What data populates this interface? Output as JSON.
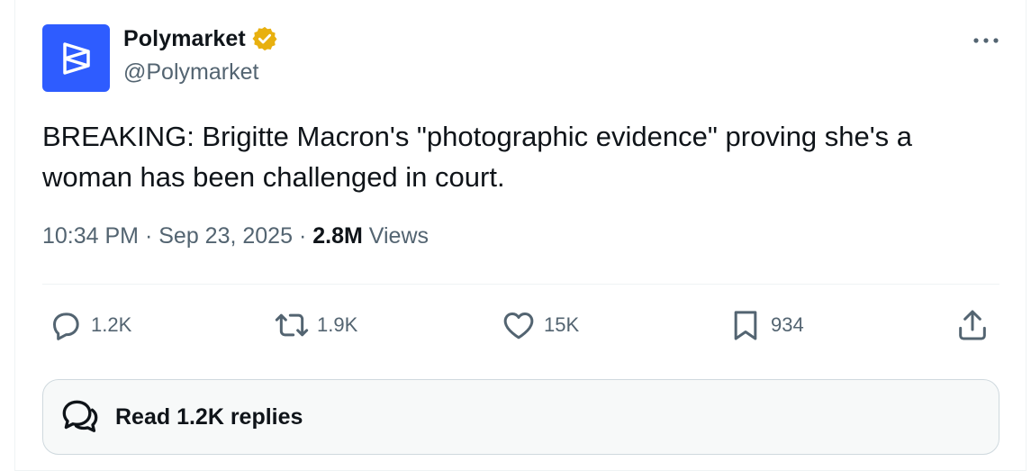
{
  "author": {
    "display_name": "Polymarket",
    "handle": "@Polymarket",
    "verified": true,
    "avatar_color": "#2e5cff",
    "verified_color": "#e8b00f"
  },
  "tweet": {
    "text": "BREAKING: Brigitte Macron's \"photographic evidence\" proving she's a woman has been challenged in court.",
    "time": "10:34 PM",
    "separator": "·",
    "date": "Sep 23, 2025",
    "views_count": "2.8M",
    "views_label": "Views"
  },
  "actions": {
    "replies": "1.2K",
    "reposts": "1.9K",
    "likes": "15K",
    "bookmarks": "934"
  },
  "read_replies": {
    "label": "Read 1.2K replies"
  },
  "icons": {
    "more": "more-horizontal-icon",
    "reply": "reply-icon",
    "repost": "repost-icon",
    "like": "heart-icon",
    "bookmark": "bookmark-icon",
    "share": "share-icon",
    "conversation": "conversation-icon"
  },
  "colors": {
    "text_primary": "#0f1419",
    "text_secondary": "#536471",
    "border": "#eff3f4"
  }
}
